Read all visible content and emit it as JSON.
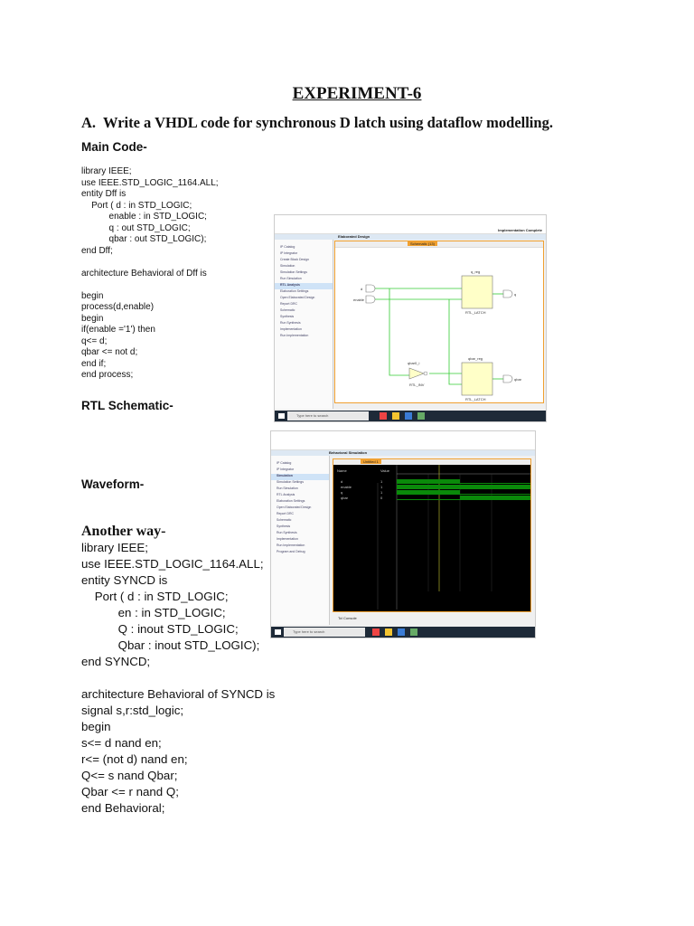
{
  "title": "EXPERIMENT-6",
  "question": "A.  Write a VHDL code for synchronous D latch using dataflow modelling.",
  "main_code_heading": "Main Code-",
  "main_code": [
    "library IEEE;",
    "use IEEE.STD_LOGIC_1164.ALL;",
    "entity Dff is",
    "    Port ( d : in STD_LOGIC;",
    "           enable : in STD_LOGIC;",
    "           q : out STD_LOGIC;",
    "           qbar : out STD_LOGIC);",
    "end Dff;",
    "",
    "architecture Behavioral of Dff is",
    "",
    "begin",
    "process(d,enable)",
    "begin",
    "if(enable ='1') then",
    "q<= d;",
    "qbar <= not d;",
    "end if;",
    "end process;"
  ],
  "rtl_heading": "RTL Schematic-",
  "waveform_heading": "Waveform-",
  "another_way_heading": "Another way-",
  "alt_code": [
    "library IEEE;",
    "use IEEE.STD_LOGIC_1164.ALL;",
    "entity SYNCD is",
    "    Port ( d : in STD_LOGIC;",
    "           en : in STD_LOGIC;",
    "           Q : inout STD_LOGIC;",
    "           Qbar : inout STD_LOGIC);",
    "end SYNCD;",
    "",
    "architecture Behavioral of SYNCD is",
    "signal s,r:std_logic;",
    "begin",
    "s<= d nand en;",
    "r<= (not d) nand en;",
    "Q<= s nand Qbar;",
    "Qbar <= r nand Q;",
    "end Behavioral;"
  ],
  "schematic_screenshot": {
    "panel_title": "Elaborated Design",
    "tab": "Schematic (13)",
    "nav": [
      "IP Catalog",
      "IP Integrator",
      "Create Block Design",
      "Simulation",
      "Simulation Settings",
      "Run Simulation",
      "RTL Analysis",
      "Elaboration Settings",
      "Open Elaborated Design",
      "Report DRC",
      "Schematic",
      "Synthesis",
      "Run Synthesis",
      "Implementation",
      "Run Implementation"
    ],
    "inputs": [
      "d",
      "enable"
    ],
    "outputs": [
      "q",
      "qbar"
    ],
    "latch_top_name": "q_reg",
    "latch_bottom_name": "qbar_reg",
    "latch_type": "RTL_LATCH",
    "inverter_name": "qbar0_i",
    "inverter_type": "RTL_INV",
    "status": "Implementation Complete",
    "taskbar_search": "Type here to search",
    "accent": "#f0a030",
    "latch_fill": "#ffffc8",
    "wire_color": "#33cc33"
  },
  "waveform_screenshot": {
    "panel_title": "Behavioral Simulation",
    "tab": "Untitled 1",
    "col_name": "Name",
    "col_value": "Value",
    "signals": [
      "d",
      "enable",
      "q",
      "qbar"
    ],
    "values": [
      "1",
      "1",
      "1",
      "0"
    ],
    "nav": [
      "IP Catalog",
      "IP Integrator",
      "Simulation",
      "Simulation Settings",
      "Run Simulation",
      "RTL Analysis",
      "Elaboration Settings",
      "Open Elaborated Design",
      "Report DRC",
      "Schematic",
      "Synthesis",
      "Run Synthesis",
      "Implementation",
      "Run Implementation",
      "Program and Debug"
    ],
    "console_tab": "Tcl Console",
    "taskbar_search": "Type here to search",
    "wave_color": "#0a8a0a"
  }
}
